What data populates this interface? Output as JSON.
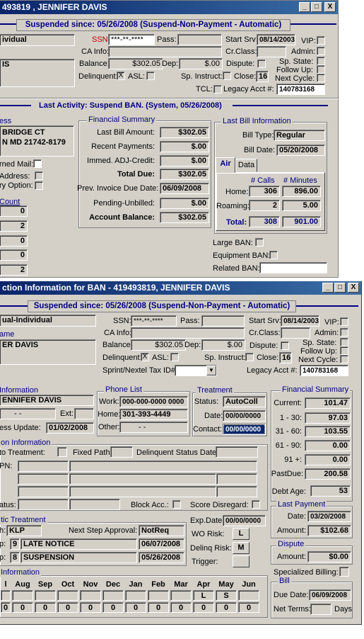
{
  "win1": {
    "title": "493819 , JENNIFER DAVIS",
    "btn_min": "_",
    "btn_max": "□",
    "btn_close": "X",
    "status_banner": "Suspended since: 05/26/2008 (Suspend-Non-Payment - Automatic)",
    "account_type": "ividual",
    "name_box": "IS",
    "ssn_label": "SSN:",
    "ssn_value": "***-**-****",
    "pass_label": "Pass:",
    "start_srv_label": "Start Srv:",
    "start_srv_value": "08/14/2003",
    "vip_label": "VIP:",
    "ca_info_label": "CA Info:",
    "cr_class_label": "Cr.Class:",
    "admin_label": "Admin:",
    "balance_label": "Balance:",
    "balance_value": "$302.05",
    "dep_label": "Dep:",
    "dep_value": "$.00",
    "dispute_label": "Dispute:",
    "sp_state_label": "Sp. State:",
    "follow_up_label": "Follow Up:",
    "next_cycle_label": "Next Cycle:",
    "delinquent_label": "Delinquent:",
    "delinquent_mark": "X",
    "asl_label": "ASL:",
    "sp_instruct_label": "Sp. Instruct:",
    "close_label": "Close:",
    "close_value": "16",
    "tcl_label": "TCL:",
    "legacy_label": "Legacy Acct #:",
    "legacy_value": "140783168",
    "activity_banner": "Last Activity: Suspend BAN. (System, 05/26/2008)",
    "address_label": "ess",
    "address_line1": "BRIDGE CT",
    "address_line2": "N MD 21742-8179",
    "returned_mail_label": "rned Mail:",
    "address_chk_label": "Address:",
    "ry_option_label": "ry Option:",
    "count_label": "Count",
    "counts": [
      "0",
      "2",
      "0",
      "0",
      "2"
    ],
    "fin_summary_label": "Financial Summary",
    "last_bill_amt_label": "Last Bill Amount:",
    "last_bill_amt": "$302.05",
    "recent_payments_label": "Recent Payments:",
    "recent_payments": "$.00",
    "immed_adj_label": "Immed. ADJ-Credit:",
    "immed_adj": "$.00",
    "total_due_label": "Total Due:",
    "total_due": "$302.05",
    "prev_invoice_label": "Prev. Invoice Due Date:",
    "prev_invoice": "06/09/2008",
    "pending_label": "Pending-Unbilled:",
    "pending": "$.00",
    "acct_balance_label": "Account Balance:",
    "acct_balance": "$302.05",
    "last_bill_info_label": "Last Bill Information",
    "bill_type_label": "Bill Type:",
    "bill_type": "Regular",
    "bill_date_label": "Bill Date:",
    "bill_date": "05/20/2008",
    "tab_air": "Air",
    "tab_data": "Data",
    "calls_header": "# Calls",
    "minutes_header": "# Minutes",
    "home_label": "Home:",
    "home_calls": "306",
    "home_minutes": "896.00",
    "roaming_label": "Roaming:",
    "roaming_calls": "2",
    "roaming_minutes": "5.00",
    "total_label": "Total:",
    "total_calls": "308",
    "total_minutes": "901.00",
    "large_ban_label": "Large BAN:",
    "equipment_ban_label": "Equipment BAN:",
    "related_ban_label": "Related BAN:"
  },
  "win2": {
    "title": "ction Information for BAN  - 419493819, JENNIFER DAVIS",
    "btn_min": "_",
    "btn_max": "□",
    "btn_close": "X",
    "status_banner": "Suspended since: 05/26/2008 (Suspend-Non-Payment - Automatic)",
    "account_type": "ual-Individual",
    "name_label": "ame",
    "name_value": "ER DAVIS",
    "ssn_label": "SSN:",
    "ssn_value": "***-**-****",
    "pass_label": "Pass:",
    "start_srv_label": "Start Srv:",
    "start_srv_value": "08/14/2003",
    "vip_label": "VIP:",
    "ca_info_label": "CA Info:",
    "cr_class_label": "Cr.Class:",
    "admin_label": "Admin:",
    "balance_label": "Balance:",
    "balance_value": "$302.05",
    "dep_label": "Dep:",
    "dep_value": "$.00",
    "dispute_label": "Dispute:",
    "sp_state_label": "Sp. State:",
    "follow_up_label": "Follow Up:",
    "next_cycle_label": "Next Cycle:",
    "delinquent_label": "Delinquent:",
    "delinquent_mark": "X",
    "asl_label": "ASL:",
    "sp_instruct_label": "Sp. Instruct:",
    "close_label": "Close:",
    "close_value": "16",
    "sprint_label": "Sprint/Nextel Tax ID#",
    "legacy_label": "Legacy Acct #:",
    "legacy_value": "140783168",
    "contact_info_label": "Information",
    "contact_name": "ENNIFER DAVIS",
    "contact_dash": "-   -",
    "ext_label": "Ext:",
    "ess_update_label": "ess Update:",
    "ess_update_value": "01/02/2008",
    "phone_list_label": "Phone List",
    "work_label": "Work:",
    "work_value": "000-000-0000 0000",
    "home_label": "Home:",
    "home_value": "301-393-4449",
    "other_label": "Other:",
    "other_value": "-   -",
    "treatment_label": "Treatment",
    "status_label": "Status:",
    "status_value": "AutoColl",
    "date_label": "Date:",
    "date_value": "00/00/0000",
    "contact_label": "Contact:",
    "contact_value": "00/00/0000",
    "fin_summary_label": "Financial Summary",
    "current_label": "Current:",
    "current_value": "101.47",
    "d1_30_label": "1 - 30:",
    "d1_30_value": "97.03",
    "d31_60_label": "31 - 60:",
    "d31_60_value": "103.55",
    "d61_90_label": "61 - 90:",
    "d61_90_value": "0.00",
    "d91_label": "91  +:",
    "d91_value": "0.00",
    "pastdue_label": "PastDue:",
    "pastdue_value": "200.58",
    "debt_age_label": "Debt Age:",
    "debt_age_value": "53",
    "collection_info_label": "on Information",
    "to_treatment_label": "to Treatment:",
    "fixed_path_label": "Fixed Path:",
    "delinq_status_label": "Delinquent Status Date:",
    "pn_label": "PN:",
    "atus_label": "atus:",
    "block_acc_label": "Block Acc.:",
    "score_disregard_label": "Score Disregard:",
    "exp_date_label": "Exp.Date:",
    "exp_date_value": "00/00/0000",
    "wo_risk_label": "WO Risk:",
    "wo_risk_value": "L",
    "delinq_risk_label": "Delinq Risk:",
    "delinq_risk_value": "M",
    "trigger_label": "Trigger:",
    "ic_treatment_label": "tic Treatment",
    "path_label": "h:",
    "path_value": "KLP",
    "next_step_label": "Next Step Approval:",
    "next_step_value": "NotReq",
    "step1_prefix": "p:",
    "step1_num": "9",
    "step1_name": "LATE NOTICE",
    "step1_date": "06/07/2008",
    "step2_prefix": "p:",
    "step2_num": "8",
    "step2_name": "SUSPENSION",
    "step2_date": "05/26/2008",
    "history_label": "Information",
    "months": [
      "l",
      "Aug",
      "Sep",
      "Oct",
      "Nov",
      "Dec",
      "Jan",
      "Feb",
      "Mar",
      "Apr",
      "May",
      "Jun"
    ],
    "month_flags": [
      "",
      "",
      "",
      "",
      "",
      "",
      "",
      "",
      "",
      "L",
      "S",
      ""
    ],
    "month_values": [
      "0",
      "0",
      "0",
      "0",
      "0",
      "0",
      "0",
      "0",
      "0",
      "0",
      "0",
      "0"
    ],
    "last_payment_label": "Last Payment",
    "lp_date_label": "Date:",
    "lp_date_value": "03/20/2008",
    "lp_amount_label": "Amount:",
    "lp_amount_value": "$102.68",
    "dispute_group_label": "Dispute",
    "disp_amount_label": "Amount:",
    "disp_amount_value": "$0.00",
    "specialized_billing_label": "Specialized Billing:",
    "bill_group_label": "Bill",
    "due_date_label": "Due Date:",
    "due_date_value": "06/09/2008",
    "net_terms_label": "Net Terms:",
    "days_label": "Days"
  }
}
